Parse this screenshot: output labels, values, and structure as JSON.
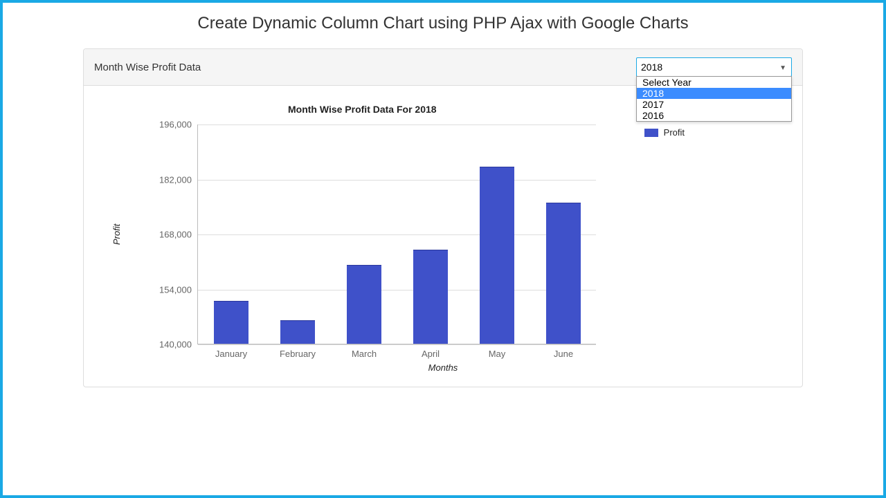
{
  "page": {
    "title": "Create Dynamic Column Chart using PHP Ajax with Google Charts"
  },
  "panel": {
    "title": "Month Wise Profit Data"
  },
  "year_select": {
    "selected": "2018",
    "options": [
      "Select Year",
      "2018",
      "2017",
      "2016"
    ]
  },
  "legend": {
    "series": "Profit"
  },
  "chart_data": {
    "type": "bar",
    "title": "Month Wise Profit Data For 2018",
    "xlabel": "Months",
    "ylabel": "Profit",
    "ylim": [
      140000,
      196000
    ],
    "y_ticks": [
      140000,
      154000,
      168000,
      182000,
      196000
    ],
    "y_tick_labels": [
      "140,000",
      "154,000",
      "168,000",
      "182,000",
      "196,000"
    ],
    "categories": [
      "January",
      "February",
      "March",
      "April",
      "May",
      "June"
    ],
    "series": [
      {
        "name": "Profit",
        "values": [
          151000,
          146000,
          160000,
          164000,
          185000,
          176000
        ]
      }
    ]
  }
}
